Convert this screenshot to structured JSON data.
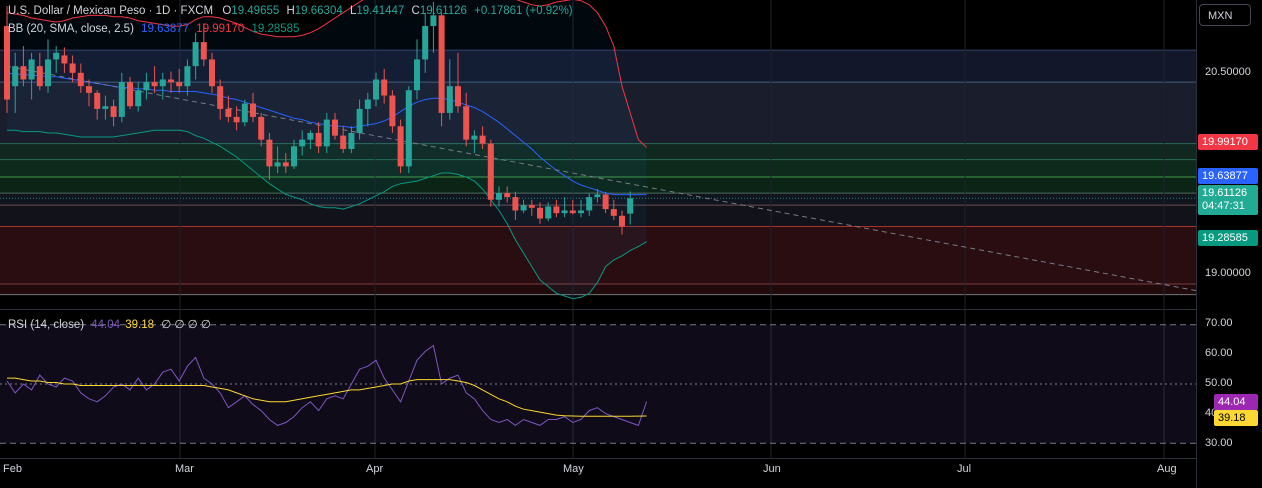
{
  "header": {
    "symbol_title": "U.S. Dollar / Mexican Peso · 1D · FXCM",
    "open_label": "O",
    "open": "19.49655",
    "high_label": "H",
    "high": "19.66304",
    "low_label": "L",
    "low": "19.41447",
    "close_label": "C",
    "close": "19.61126",
    "change": "+0.17861 (+0.92%)"
  },
  "bb_legend": {
    "label": "BB (20, SMA, close, 2.5)",
    "basis": "19.63877",
    "upper": "19.99170",
    "lower": "19.28585"
  },
  "rsi_legend": {
    "label": "RSI (14, close)",
    "rsi": "44.04",
    "ma": "39.18",
    "extra": "∅ ∅ ∅ ∅"
  },
  "currency_button": "MXN",
  "price_axis": {
    "ticks": [
      "20.50000",
      "19.00000"
    ],
    "labels": {
      "upper": "19.99170",
      "basis": "19.63877",
      "last_price": "19.61126",
      "countdown": "04:47:31",
      "lower": "19.28585"
    }
  },
  "rsi_axis": {
    "ticks": [
      "70.00",
      "60.00",
      "50.00",
      "40.00",
      "30.00"
    ],
    "labels": {
      "rsi": "44.04",
      "ma": "39.18"
    }
  },
  "time_axis": [
    "Feb",
    "Mar",
    "Apr",
    "May",
    "Jun",
    "Jul",
    "Aug"
  ],
  "colors": {
    "up": "#26a69a",
    "down": "#ef5350",
    "bb_basis": "#2962ff",
    "bb_upper": "#f23645",
    "bb_lower": "#089981",
    "rsi": "#7e57c2",
    "rsi_ma": "#fdd835"
  },
  "chart_data": [
    {
      "type": "candlestick",
      "title": "U.S. Dollar / Mexican Peso · 1D · FXCM",
      "x_range": [
        "2024-01-31",
        "2024-08-10"
      ],
      "ylim": [
        18.82,
        21.08
      ],
      "candles": [
        {
          "o": 20.9,
          "h": 21.05,
          "l": 20.25,
          "c": 20.35
        },
        {
          "o": 20.45,
          "h": 20.7,
          "l": 20.25,
          "c": 20.6
        },
        {
          "o": 20.6,
          "h": 20.75,
          "l": 20.45,
          "c": 20.5
        },
        {
          "o": 20.5,
          "h": 20.7,
          "l": 20.35,
          "c": 20.65
        },
        {
          "o": 20.6,
          "h": 20.7,
          "l": 20.42,
          "c": 20.45
        },
        {
          "o": 20.45,
          "h": 20.8,
          "l": 20.4,
          "c": 20.65
        },
        {
          "o": 20.65,
          "h": 20.75,
          "l": 20.55,
          "c": 20.7
        },
        {
          "o": 20.68,
          "h": 20.74,
          "l": 20.55,
          "c": 20.62
        },
        {
          "o": 20.62,
          "h": 20.68,
          "l": 20.48,
          "c": 20.55
        },
        {
          "o": 20.55,
          "h": 20.62,
          "l": 20.4,
          "c": 20.45
        },
        {
          "o": 20.45,
          "h": 20.5,
          "l": 20.3,
          "c": 20.4
        },
        {
          "o": 20.4,
          "h": 20.42,
          "l": 20.2,
          "c": 20.28
        },
        {
          "o": 20.28,
          "h": 20.38,
          "l": 20.2,
          "c": 20.3
        },
        {
          "o": 20.3,
          "h": 20.35,
          "l": 20.15,
          "c": 20.22
        },
        {
          "o": 20.22,
          "h": 20.55,
          "l": 20.18,
          "c": 20.48
        },
        {
          "o": 20.48,
          "h": 20.52,
          "l": 20.28,
          "c": 20.3
        },
        {
          "o": 20.3,
          "h": 20.48,
          "l": 20.26,
          "c": 20.42
        },
        {
          "o": 20.42,
          "h": 20.55,
          "l": 20.35,
          "c": 20.48
        },
        {
          "o": 20.48,
          "h": 20.6,
          "l": 20.4,
          "c": 20.45
        },
        {
          "o": 20.45,
          "h": 20.55,
          "l": 20.35,
          "c": 20.5
        },
        {
          "o": 20.5,
          "h": 20.56,
          "l": 20.4,
          "c": 20.48
        },
        {
          "o": 20.48,
          "h": 20.58,
          "l": 20.4,
          "c": 20.45
        },
        {
          "o": 20.45,
          "h": 20.65,
          "l": 20.38,
          "c": 20.6
        },
        {
          "o": 20.6,
          "h": 20.85,
          "l": 20.5,
          "c": 20.78
        },
        {
          "o": 20.78,
          "h": 20.92,
          "l": 20.6,
          "c": 20.65
        },
        {
          "o": 20.65,
          "h": 20.7,
          "l": 20.4,
          "c": 20.45
        },
        {
          "o": 20.45,
          "h": 20.5,
          "l": 20.2,
          "c": 20.28
        },
        {
          "o": 20.28,
          "h": 20.38,
          "l": 20.18,
          "c": 20.22
        },
        {
          "o": 20.22,
          "h": 20.3,
          "l": 20.12,
          "c": 20.18
        },
        {
          "o": 20.18,
          "h": 20.35,
          "l": 20.15,
          "c": 20.32
        },
        {
          "o": 20.32,
          "h": 20.4,
          "l": 20.18,
          "c": 20.22
        },
        {
          "o": 20.22,
          "h": 20.25,
          "l": 20.0,
          "c": 20.05
        },
        {
          "o": 20.05,
          "h": 20.1,
          "l": 19.75,
          "c": 19.85
        },
        {
          "o": 19.85,
          "h": 20.0,
          "l": 19.8,
          "c": 19.88
        },
        {
          "o": 19.88,
          "h": 19.95,
          "l": 19.8,
          "c": 19.85
        },
        {
          "o": 19.85,
          "h": 20.05,
          "l": 19.83,
          "c": 20.0
        },
        {
          "o": 20.0,
          "h": 20.12,
          "l": 19.93,
          "c": 20.05
        },
        {
          "o": 20.05,
          "h": 20.12,
          "l": 19.98,
          "c": 20.1
        },
        {
          "o": 20.1,
          "h": 20.18,
          "l": 19.95,
          "c": 20.0
        },
        {
          "o": 20.0,
          "h": 20.25,
          "l": 19.95,
          "c": 20.2
        },
        {
          "o": 20.2,
          "h": 20.25,
          "l": 20.05,
          "c": 20.08
        },
        {
          "o": 20.08,
          "h": 20.15,
          "l": 19.95,
          "c": 19.98
        },
        {
          "o": 19.98,
          "h": 20.15,
          "l": 19.95,
          "c": 20.1
        },
        {
          "o": 20.1,
          "h": 20.35,
          "l": 20.05,
          "c": 20.28
        },
        {
          "o": 20.28,
          "h": 20.4,
          "l": 20.15,
          "c": 20.35
        },
        {
          "o": 20.35,
          "h": 20.55,
          "l": 20.3,
          "c": 20.5
        },
        {
          "o": 20.5,
          "h": 20.58,
          "l": 20.32,
          "c": 20.38
        },
        {
          "o": 20.38,
          "h": 20.42,
          "l": 20.1,
          "c": 20.15
        },
        {
          "o": 20.15,
          "h": 20.2,
          "l": 19.8,
          "c": 19.85
        },
        {
          "o": 19.85,
          "h": 20.45,
          "l": 19.8,
          "c": 20.42
        },
        {
          "o": 20.42,
          "h": 20.8,
          "l": 20.35,
          "c": 20.65
        },
        {
          "o": 20.65,
          "h": 21.0,
          "l": 20.55,
          "c": 20.9
        },
        {
          "o": 20.9,
          "h": 21.08,
          "l": 20.7,
          "c": 20.98
        },
        {
          "o": 20.98,
          "h": 21.0,
          "l": 20.15,
          "c": 20.25
        },
        {
          "o": 20.25,
          "h": 20.65,
          "l": 20.2,
          "c": 20.45
        },
        {
          "o": 20.45,
          "h": 20.7,
          "l": 20.25,
          "c": 20.3
        },
        {
          "o": 20.3,
          "h": 20.4,
          "l": 20.0,
          "c": 20.05
        },
        {
          "o": 20.05,
          "h": 20.12,
          "l": 19.95,
          "c": 20.08
        },
        {
          "o": 20.08,
          "h": 20.15,
          "l": 19.98,
          "c": 20.02
        },
        {
          "o": 20.02,
          "h": 20.05,
          "l": 19.55,
          "c": 19.6
        },
        {
          "o": 19.6,
          "h": 19.7,
          "l": 19.55,
          "c": 19.65
        },
        {
          "o": 19.65,
          "h": 19.7,
          "l": 19.58,
          "c": 19.62
        },
        {
          "o": 19.62,
          "h": 19.66,
          "l": 19.45,
          "c": 19.52
        },
        {
          "o": 19.52,
          "h": 19.6,
          "l": 19.5,
          "c": 19.56
        },
        {
          "o": 19.56,
          "h": 19.6,
          "l": 19.48,
          "c": 19.54
        },
        {
          "o": 19.54,
          "h": 19.58,
          "l": 19.42,
          "c": 19.46
        },
        {
          "o": 19.46,
          "h": 19.58,
          "l": 19.44,
          "c": 19.55
        },
        {
          "o": 19.55,
          "h": 19.6,
          "l": 19.47,
          "c": 19.5
        },
        {
          "o": 19.5,
          "h": 19.62,
          "l": 19.47,
          "c": 19.52
        },
        {
          "o": 19.52,
          "h": 19.6,
          "l": 19.49,
          "c": 19.5
        },
        {
          "o": 19.5,
          "h": 19.6,
          "l": 19.47,
          "c": 19.52
        },
        {
          "o": 19.52,
          "h": 19.65,
          "l": 19.48,
          "c": 19.62
        },
        {
          "o": 19.62,
          "h": 19.68,
          "l": 19.58,
          "c": 19.64
        },
        {
          "o": 19.64,
          "h": 19.66,
          "l": 19.5,
          "c": 19.53
        },
        {
          "o": 19.53,
          "h": 19.6,
          "l": 19.45,
          "c": 19.48
        },
        {
          "o": 19.48,
          "h": 19.52,
          "l": 19.34,
          "c": 19.4
        },
        {
          "o": 19.49655,
          "h": 19.66304,
          "l": 19.41447,
          "c": 19.61126
        }
      ],
      "bb_upper": [
        21.0,
        20.99,
        20.98,
        20.96,
        20.95,
        20.94,
        20.93,
        20.94,
        20.96,
        20.97,
        20.98,
        20.98,
        20.98,
        20.97,
        20.97,
        20.96,
        20.94,
        20.93,
        20.92,
        20.91,
        20.9,
        20.9,
        20.91,
        20.95,
        20.97,
        20.97,
        20.96,
        20.94,
        20.92,
        20.89,
        20.86,
        20.84,
        20.83,
        20.82,
        20.82,
        20.82,
        20.83,
        20.85,
        20.88,
        20.92,
        20.96,
        21.0,
        21.04,
        21.08,
        21.12,
        21.16,
        21.2,
        21.25,
        21.28,
        21.3,
        21.3,
        21.3,
        21.3,
        21.29,
        21.28,
        21.26,
        21.24,
        21.22,
        21.2,
        21.18,
        21.15,
        21.12,
        21.1,
        21.08,
        21.06,
        21.05,
        21.06,
        21.08,
        21.09,
        21.1,
        21.09,
        21.06,
        21.0,
        20.9,
        20.75,
        20.45,
        20.25,
        20.05,
        19.9917
      ],
      "bb_basis": [
        20.55,
        20.54,
        20.54,
        20.53,
        20.53,
        20.52,
        20.52,
        20.51,
        20.5,
        20.49,
        20.48,
        20.47,
        20.46,
        20.45,
        20.44,
        20.44,
        20.43,
        20.43,
        20.42,
        20.42,
        20.41,
        20.41,
        20.41,
        20.41,
        20.4,
        20.39,
        20.38,
        20.36,
        20.35,
        20.33,
        20.31,
        20.29,
        20.27,
        20.25,
        20.23,
        20.21,
        20.2,
        20.18,
        20.17,
        20.16,
        20.15,
        20.15,
        20.14,
        20.15,
        20.16,
        20.17,
        20.19,
        20.22,
        20.26,
        20.3,
        20.33,
        20.35,
        20.36,
        20.36,
        20.35,
        20.33,
        20.31,
        20.29,
        20.26,
        20.22,
        20.18,
        20.13,
        20.08,
        20.03,
        19.98,
        19.92,
        19.87,
        19.82,
        19.78,
        19.74,
        19.71,
        19.69,
        19.67,
        19.65,
        19.63877,
        19.63877,
        19.63877,
        19.63877,
        19.63877
      ],
      "bb_lower": [
        20.12,
        20.12,
        20.11,
        20.11,
        20.11,
        20.1,
        20.1,
        20.09,
        20.08,
        20.07,
        20.07,
        20.07,
        20.07,
        20.07,
        20.08,
        20.09,
        20.1,
        20.11,
        20.12,
        20.12,
        20.12,
        20.12,
        20.11,
        20.08,
        20.06,
        20.03,
        20.0,
        19.96,
        19.92,
        19.87,
        19.82,
        19.77,
        19.72,
        19.68,
        19.64,
        19.62,
        19.6,
        19.57,
        19.55,
        19.54,
        19.54,
        19.53,
        19.55,
        19.57,
        19.6,
        19.63,
        19.66,
        19.7,
        19.72,
        19.73,
        19.74,
        19.76,
        19.78,
        19.8,
        19.8,
        19.79,
        19.77,
        19.74,
        19.68,
        19.6,
        19.52,
        19.42,
        19.3,
        19.2,
        19.1,
        19.0,
        18.95,
        18.9,
        18.88,
        18.86,
        18.87,
        18.9,
        18.98,
        19.1,
        19.15,
        19.18,
        19.22,
        19.25,
        19.28585
      ],
      "trendline": {
        "start": {
          "x": "2024-02-01",
          "y": 20.6
        },
        "end": {
          "x": "2024-08-10",
          "y": 18.92
        }
      },
      "horizontal_levels": [
        20.72,
        20.48,
        20.02,
        19.9,
        19.77,
        19.65,
        19.56,
        19.4,
        18.97,
        18.89
      ],
      "x_ticks": [
        "Feb",
        "Mar",
        "Apr",
        "May",
        "Jun",
        "Jul",
        "Aug"
      ],
      "y_ticks": [
        20.5,
        19.0
      ]
    },
    {
      "type": "line",
      "title": "RSI (14, close)",
      "ylim": [
        25,
        75
      ],
      "y_ticks": [
        70,
        60,
        50,
        40,
        30
      ],
      "series": [
        {
          "name": "RSI",
          "values": [
            51,
            47,
            50,
            48,
            53,
            50,
            49,
            52,
            51,
            47,
            45,
            44,
            46,
            49,
            50,
            48,
            52,
            48,
            50,
            54,
            55,
            51,
            56,
            59,
            52,
            50,
            47,
            42,
            44,
            46,
            43,
            41,
            38,
            36,
            37,
            39,
            42,
            44,
            41,
            45,
            46,
            45,
            50,
            55,
            56,
            58,
            52,
            48,
            44,
            51,
            58,
            61,
            63,
            50,
            52,
            53,
            47,
            45,
            41,
            38,
            37,
            38,
            36,
            38,
            37,
            36,
            38,
            38,
            39,
            37,
            38,
            41,
            42,
            40,
            39,
            38,
            37,
            36,
            44.04
          ]
        },
        {
          "name": "RSI-based MA",
          "values": [
            52,
            52,
            51.5,
            51,
            51,
            50.5,
            50.5,
            50,
            50,
            49.5,
            49.5,
            49.5,
            49.5,
            49.5,
            49.5,
            49.5,
            49.5,
            49.5,
            49.5,
            49.5,
            49.5,
            49.5,
            49.5,
            49.5,
            49.5,
            49,
            48.5,
            48,
            47,
            46,
            45,
            44.5,
            44,
            44,
            44,
            44.5,
            45,
            45.5,
            46,
            46.5,
            47,
            47.5,
            48,
            48,
            48.5,
            49,
            49.5,
            50,
            50,
            51,
            51.5,
            51.5,
            51.5,
            51.5,
            51.5,
            51,
            50.5,
            49.5,
            48,
            46.5,
            45,
            44,
            42.5,
            41.5,
            41,
            40.5,
            40,
            39.5,
            39.3,
            39.2,
            39.1,
            39.1,
            39.1,
            39.1,
            39.1,
            39.1,
            39.1,
            39.15,
            39.18
          ]
        }
      ],
      "bands": [
        70,
        50,
        30
      ]
    }
  ]
}
